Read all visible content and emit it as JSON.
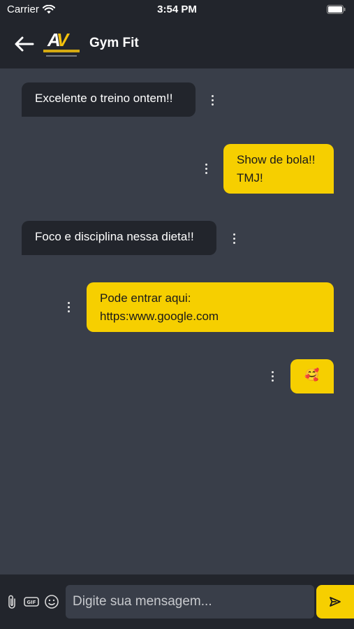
{
  "status_bar": {
    "carrier": "Carrier",
    "time": "3:54 PM"
  },
  "header": {
    "title": "Gym Fit",
    "logo_icon": "angelo-valverde-logo-icon",
    "back_icon": "arrow-left-icon"
  },
  "messages": [
    {
      "direction": "received",
      "text": "Excelente o treino ontem!!"
    },
    {
      "direction": "sent",
      "lines": [
        "Show de bola!!",
        "TMJ!"
      ]
    },
    {
      "direction": "received",
      "text": "Foco e disciplina nessa dieta!!"
    },
    {
      "direction": "sent",
      "lines": [
        "Pode entrar aqui:",
        "https:www.google.com"
      ]
    },
    {
      "direction": "sent",
      "text": "🥰"
    }
  ],
  "composer": {
    "placeholder": "Digite sua mensagem...",
    "value": "",
    "attach_icon": "paperclip-icon",
    "gif_icon": "gif-icon",
    "emoji_icon": "smiley-icon",
    "send_icon": "send-icon"
  },
  "colors": {
    "background": "#393e49",
    "header": "#22252c",
    "received_bubble": "#22252c",
    "sent_bubble": "#f6cf00",
    "accent": "#f6cf00"
  }
}
